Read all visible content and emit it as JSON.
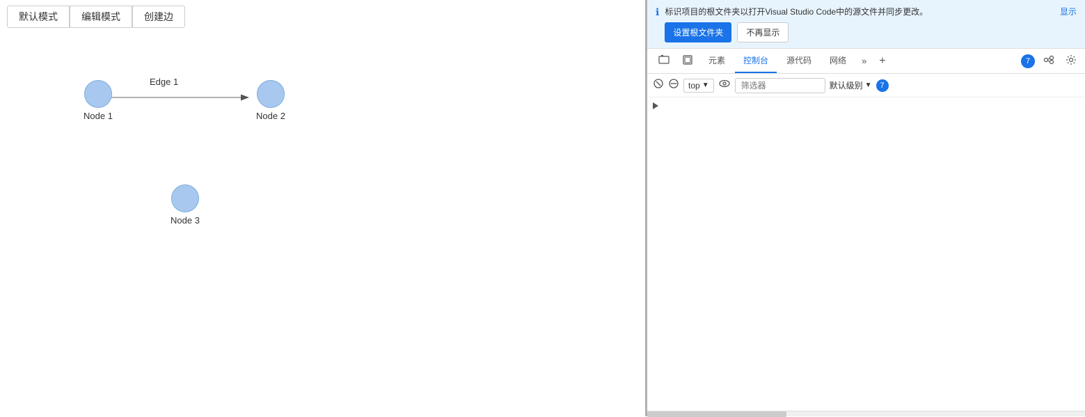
{
  "toolbar": {
    "btn1": "默认模式",
    "btn2": "编辑模式",
    "btn3": "创建边"
  },
  "graph": {
    "node1": {
      "label": "Node 1"
    },
    "node2": {
      "label": "Node 2"
    },
    "node3": {
      "label": "Node 3"
    },
    "edge1": {
      "label": "Edge 1"
    }
  },
  "infoBanner": {
    "text": "标识项目的根文件夹以打开Visual Studio Code中的源文件并同步更改。",
    "showLink": "显示",
    "btn1": "设置根文件夹",
    "btn2": "不再显示"
  },
  "devtools": {
    "tabs": [
      {
        "label": "元素",
        "active": false
      },
      {
        "label": "控制台",
        "active": true
      },
      {
        "label": "源代码",
        "active": false
      },
      {
        "label": "网络",
        "active": false
      }
    ],
    "badgeCount": "7",
    "moreIcon": "»",
    "addIcon": "+"
  },
  "consoleToolbar": {
    "topLabel": "top",
    "filterPlaceholder": "筛选器",
    "levelLabel": "默认级别",
    "levelBadge": "7"
  },
  "icons": {
    "info": "ℹ",
    "ban": "⊘",
    "eye": "👁",
    "gear": "⚙",
    "screenshot": "📷",
    "layers": "⧉",
    "people": "👥",
    "chevronDown": "▼",
    "chevronRight": "▶"
  }
}
